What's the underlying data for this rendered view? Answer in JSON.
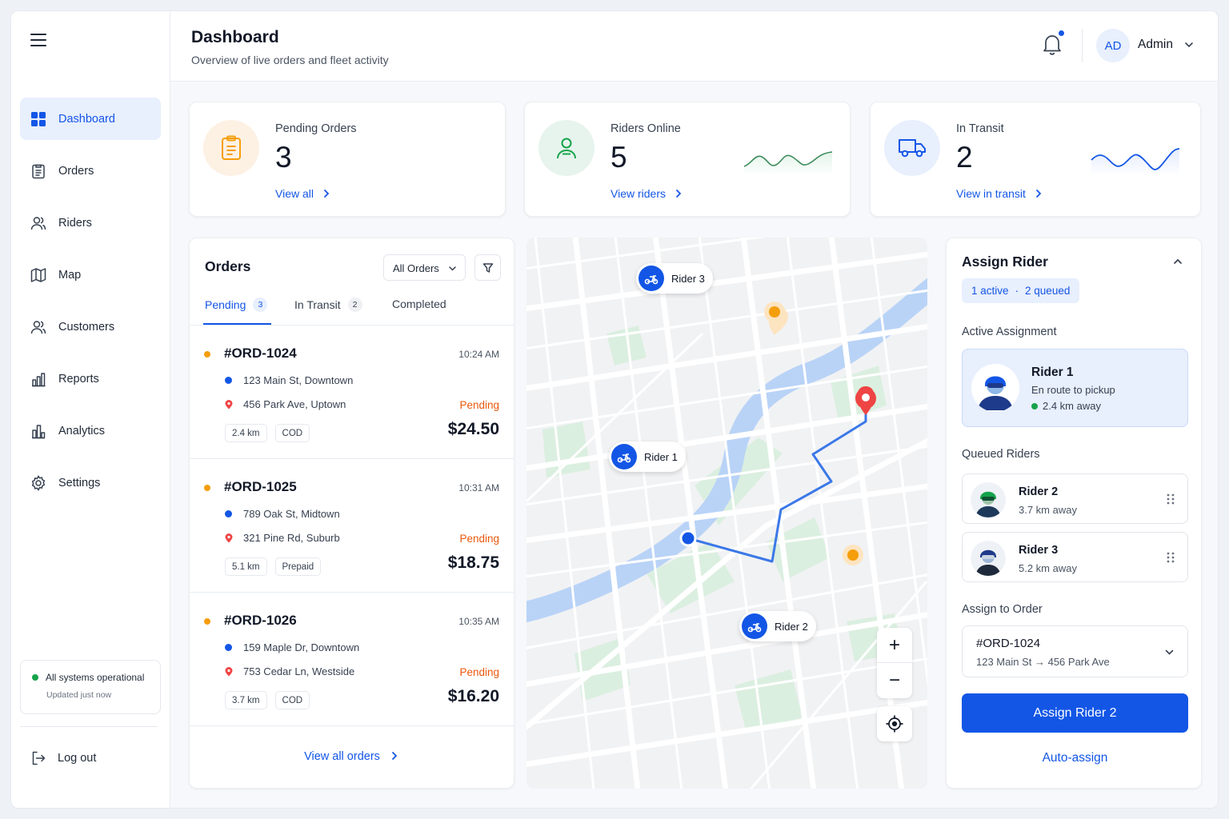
{
  "sidebar": {
    "items": [
      {
        "label": "Dashboard"
      },
      {
        "label": "Orders"
      },
      {
        "label": "Riders"
      },
      {
        "label": "Map"
      },
      {
        "label": "Customers"
      },
      {
        "label": "Reports"
      },
      {
        "label": "Analytics"
      },
      {
        "label": "Settings"
      }
    ],
    "status": {
      "text": "All systems operational",
      "updated": "Updated just now"
    },
    "logout": "Log out"
  },
  "header": {
    "title": "Dashboard",
    "subtitle": "Overview of live orders and fleet activity",
    "user": {
      "initials": "AD",
      "name": "Admin"
    }
  },
  "stats": [
    {
      "label": "Pending Orders",
      "value": "3",
      "link": "View all"
    },
    {
      "label": "Riders Online",
      "value": "5",
      "link": "View riders"
    },
    {
      "label": "In Transit",
      "value": "2",
      "link": "View in transit"
    }
  ],
  "orders": {
    "title": "Orders",
    "filter": "All Orders",
    "tabs": [
      {
        "label": "Pending",
        "count": "3"
      },
      {
        "label": "In Transit",
        "count": "2"
      },
      {
        "label": "Completed"
      }
    ],
    "list": [
      {
        "id": "#ORD-1024",
        "time": "10:24 AM",
        "from": "123 Main St, Downtown",
        "to": "456 Park Ave, Uptown",
        "status": "Pending",
        "distance": "2.4 km",
        "payment": "COD",
        "price": "$24.50"
      },
      {
        "id": "#ORD-1025",
        "time": "10:31 AM",
        "from": "789 Oak St, Midtown",
        "to": "321 Pine Rd, Suburb",
        "status": "Pending",
        "distance": "5.1 km",
        "payment": "Prepaid",
        "price": "$18.75"
      },
      {
        "id": "#ORD-1026",
        "time": "10:35 AM",
        "from": "159 Maple Dr, Downtown",
        "to": "753 Cedar Ln, Westside",
        "status": "Pending",
        "distance": "3.7 km",
        "payment": "COD",
        "price": "$16.20"
      }
    ],
    "view_all": "View all orders"
  },
  "map": {
    "riders": [
      {
        "label": "Rider 3"
      },
      {
        "label": "Rider 1"
      },
      {
        "label": "Rider 2"
      }
    ],
    "zoom_in": "+",
    "zoom_out": "−"
  },
  "assign": {
    "title": "Assign Rider",
    "active_count": "1 active",
    "queued_count": "2 queued",
    "active_label": "Active Assignment",
    "active": {
      "name": "Rider 1",
      "status": "En route to pickup",
      "distance": "2.4 km away"
    },
    "queued_label": "Queued Riders",
    "queued": [
      {
        "name": "Rider 2",
        "distance": "3.7 km away"
      },
      {
        "name": "Rider 3",
        "distance": "5.2 km away"
      }
    ],
    "order_label": "Assign to Order",
    "order": {
      "id": "#ORD-1024",
      "route": "123 Main St → 456 Park Ave"
    },
    "button": "Assign Rider 2",
    "auto": "Auto-assign"
  },
  "colors": {
    "primary": "#1356e6",
    "pending": "#ea580c",
    "online": "#16a34a",
    "pin_orange": "#f59e0b",
    "pin_red": "#ef4444"
  }
}
